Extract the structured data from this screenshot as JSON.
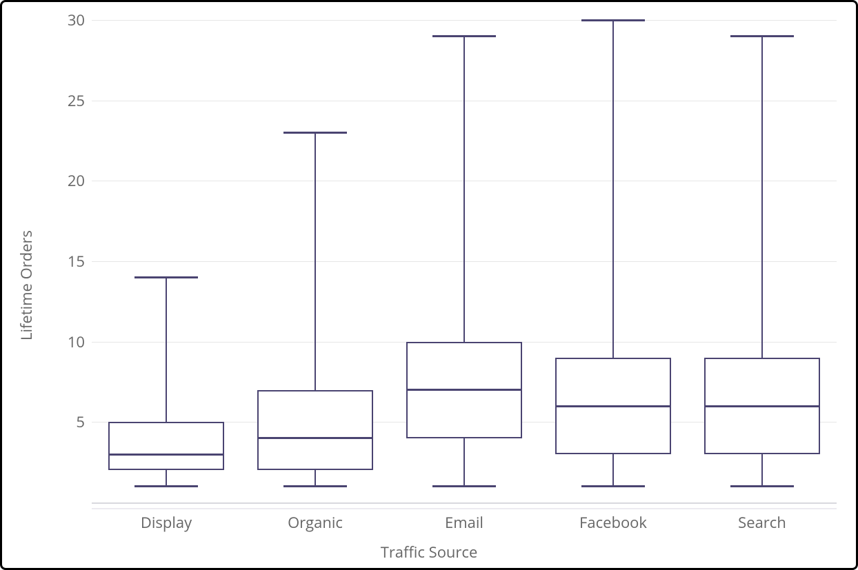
{
  "chart_data": {
    "type": "boxplot",
    "xlabel": "Traffic Source",
    "ylabel": "Lifetime Orders",
    "ylim": [
      0,
      30
    ],
    "yticks": [
      5,
      10,
      15,
      20,
      25,
      30
    ],
    "categories": [
      "Display",
      "Organic",
      "Email",
      "Facebook",
      "Search"
    ],
    "series": [
      {
        "name": "Display",
        "min": 1,
        "q1": 2,
        "median": 3,
        "q3": 5,
        "max": 14
      },
      {
        "name": "Organic",
        "min": 1,
        "q1": 2,
        "median": 4,
        "q3": 7,
        "max": 23
      },
      {
        "name": "Email",
        "min": 1,
        "q1": 4,
        "median": 7,
        "q3": 10,
        "max": 29
      },
      {
        "name": "Facebook",
        "min": 1,
        "q1": 3,
        "median": 6,
        "q3": 9,
        "max": 30
      },
      {
        "name": "Search",
        "min": 1,
        "q1": 3,
        "median": 6,
        "q3": 9,
        "max": 29
      }
    ],
    "color": "#4a4471"
  }
}
